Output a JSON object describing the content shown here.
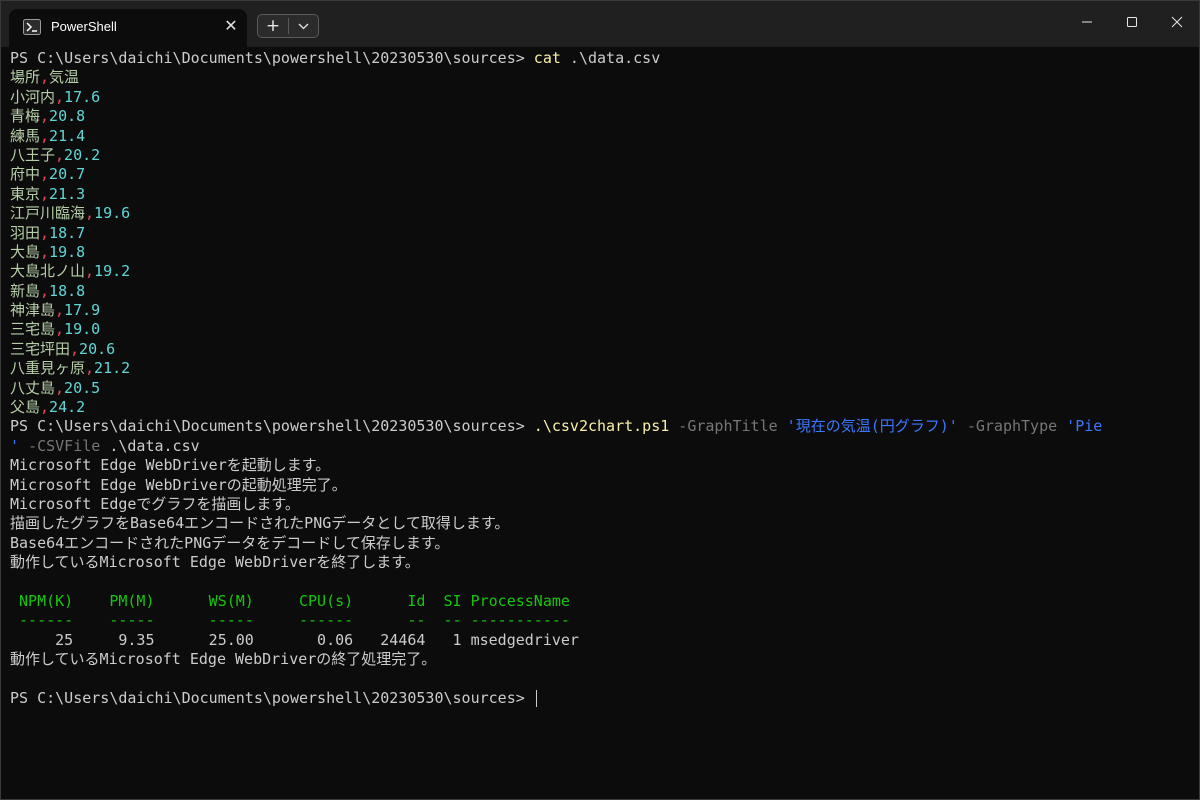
{
  "window": {
    "tab_title": "PowerShell",
    "new_tab_symbol": "+",
    "close_tab_symbol": "✕"
  },
  "terminal": {
    "prompt": "PS C:\\Users\\daichi\\Documents\\powershell\\20230530\\sources>",
    "cmd1": {
      "name": "cat",
      "arg": ".\\data.csv"
    },
    "csv_header": {
      "a": "場所",
      "b": "気温"
    },
    "csv_rows": [
      {
        "place": "小河内",
        "temp": "17.6"
      },
      {
        "place": "青梅",
        "temp": "20.8"
      },
      {
        "place": "練馬",
        "temp": "21.4"
      },
      {
        "place": "八王子",
        "temp": "20.2"
      },
      {
        "place": "府中",
        "temp": "20.7"
      },
      {
        "place": "東京",
        "temp": "21.3"
      },
      {
        "place": "江戸川臨海",
        "temp": "19.6"
      },
      {
        "place": "羽田",
        "temp": "18.7"
      },
      {
        "place": "大島",
        "temp": "19.8"
      },
      {
        "place": "大島北ノ山",
        "temp": "19.2"
      },
      {
        "place": "新島",
        "temp": "18.8"
      },
      {
        "place": "神津島",
        "temp": "17.9"
      },
      {
        "place": "三宅島",
        "temp": "19.0"
      },
      {
        "place": "三宅坪田",
        "temp": "20.6"
      },
      {
        "place": "八重見ヶ原",
        "temp": "21.2"
      },
      {
        "place": "八丈島",
        "temp": "20.5"
      },
      {
        "place": "父島",
        "temp": "24.2"
      }
    ],
    "cmd2": {
      "script": ".\\csv2chart.ps1",
      "p1": "-GraphTitle",
      "v1": "'現在の気温(円グラフ)'",
      "p2": "-GraphType",
      "v2a": "'Pie",
      "v2b": "'",
      "p3": "-CSVFile",
      "v3": ".\\data.csv"
    },
    "messages": [
      "Microsoft Edge WebDriverを起動します。",
      "Microsoft Edge WebDriverの起動処理完了。",
      "Microsoft Edgeでグラフを描画します。",
      "描画したグラフをBase64エンコードされたPNGデータとして取得します。",
      "Base64エンコードされたPNGデータをデコードして保存します。",
      "動作しているMicrosoft Edge WebDriverを終了します。"
    ],
    "table": {
      "header": " NPM(K)    PM(M)      WS(M)     CPU(s)      Id  SI ProcessName",
      "underline": " ------    -----      -----     ------      --  -- -----------",
      "row": "     25     9.35      25.00       0.06   24464   1 msedgedriver"
    },
    "final_message": "動作しているMicrosoft Edge WebDriverの終了処理完了。"
  }
}
